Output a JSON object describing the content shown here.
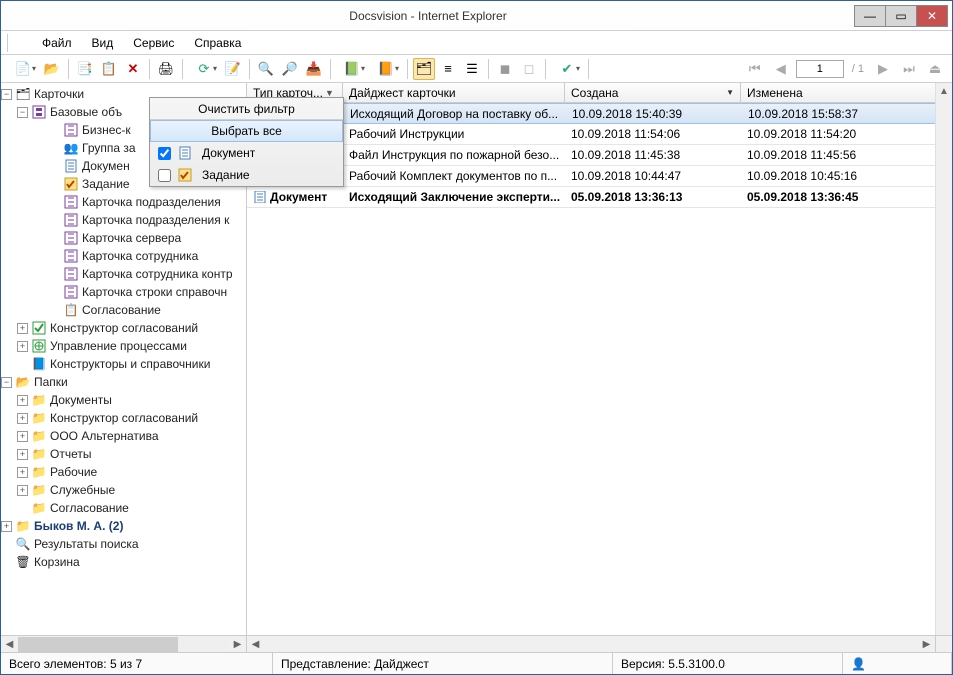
{
  "window": {
    "title": "Docsvision - Internet Explorer"
  },
  "menu": {
    "file": "Файл",
    "view": "Вид",
    "service": "Сервис",
    "help": "Справка"
  },
  "pager": {
    "page": "1",
    "of": "/ 1"
  },
  "tree": {
    "root": "Карточки",
    "base": "Базовые объ",
    "items": {
      "biz": "Бизнес-к",
      "group": "Группа за",
      "doc": "Докумен",
      "task": "Задание",
      "card_dep": "Карточка подразделения",
      "card_dep_k": "Карточка подразделения к",
      "card_srv": "Карточка сервера",
      "card_emp": "Карточка сотрудника",
      "card_emp_k": "Карточка сотрудника контр",
      "card_line": "Карточка строки справочн",
      "approval_item": "Согласование"
    },
    "approval_ctor": "Конструктор согласований",
    "proc_mgmt": "Управление процессами",
    "dictionaries": "Конструкторы и справочники",
    "folders_root": "Папки",
    "folders": {
      "docs": "Документы",
      "approval_ctor2": "Конструктор согласований",
      "ooo": "ООО Альтернатива",
      "reports": "Отчеты",
      "working": "Рабочие",
      "service": "Служебные",
      "approval": "Согласование"
    },
    "user": "Быков М. А.",
    "user_count": "(2)",
    "search": "Результаты поиска",
    "trash": "Корзина"
  },
  "columns": {
    "type": "Тип карточ...",
    "digest": "Дайджест карточки",
    "created": "Создана",
    "changed": "Изменена"
  },
  "rows": [
    {
      "digest": "Исходящий Договор на поставку об...",
      "created": "10.09.2018 15:40:39",
      "changed": "10.09.2018 15:58:37"
    },
    {
      "digest": "Рабочий Инструкции",
      "created": "10.09.2018 11:54:06",
      "changed": "10.09.2018 11:54:20"
    },
    {
      "digest": "Файл Инструкция по пожарной безо...",
      "created": "10.09.2018 11:45:38",
      "changed": "10.09.2018 11:45:56"
    },
    {
      "digest": "Рабочий Комплект документов по п...",
      "created": "10.09.2018 10:44:47",
      "changed": "10.09.2018 10:45:16"
    },
    {
      "type": "Документ",
      "digest": "Исходящий Заключение эксперти...",
      "created": "05.09.2018 13:36:13",
      "changed": "05.09.2018 13:36:45"
    }
  ],
  "context": {
    "clear": "Очистить фильтр",
    "select_all": "Выбрать все",
    "doc": "Документ",
    "task": "Задание"
  },
  "status": {
    "total": "Всего элементов: 5 из 7",
    "view": "Представление: Дайджест",
    "version": "Версия: 5.5.3100.0"
  }
}
